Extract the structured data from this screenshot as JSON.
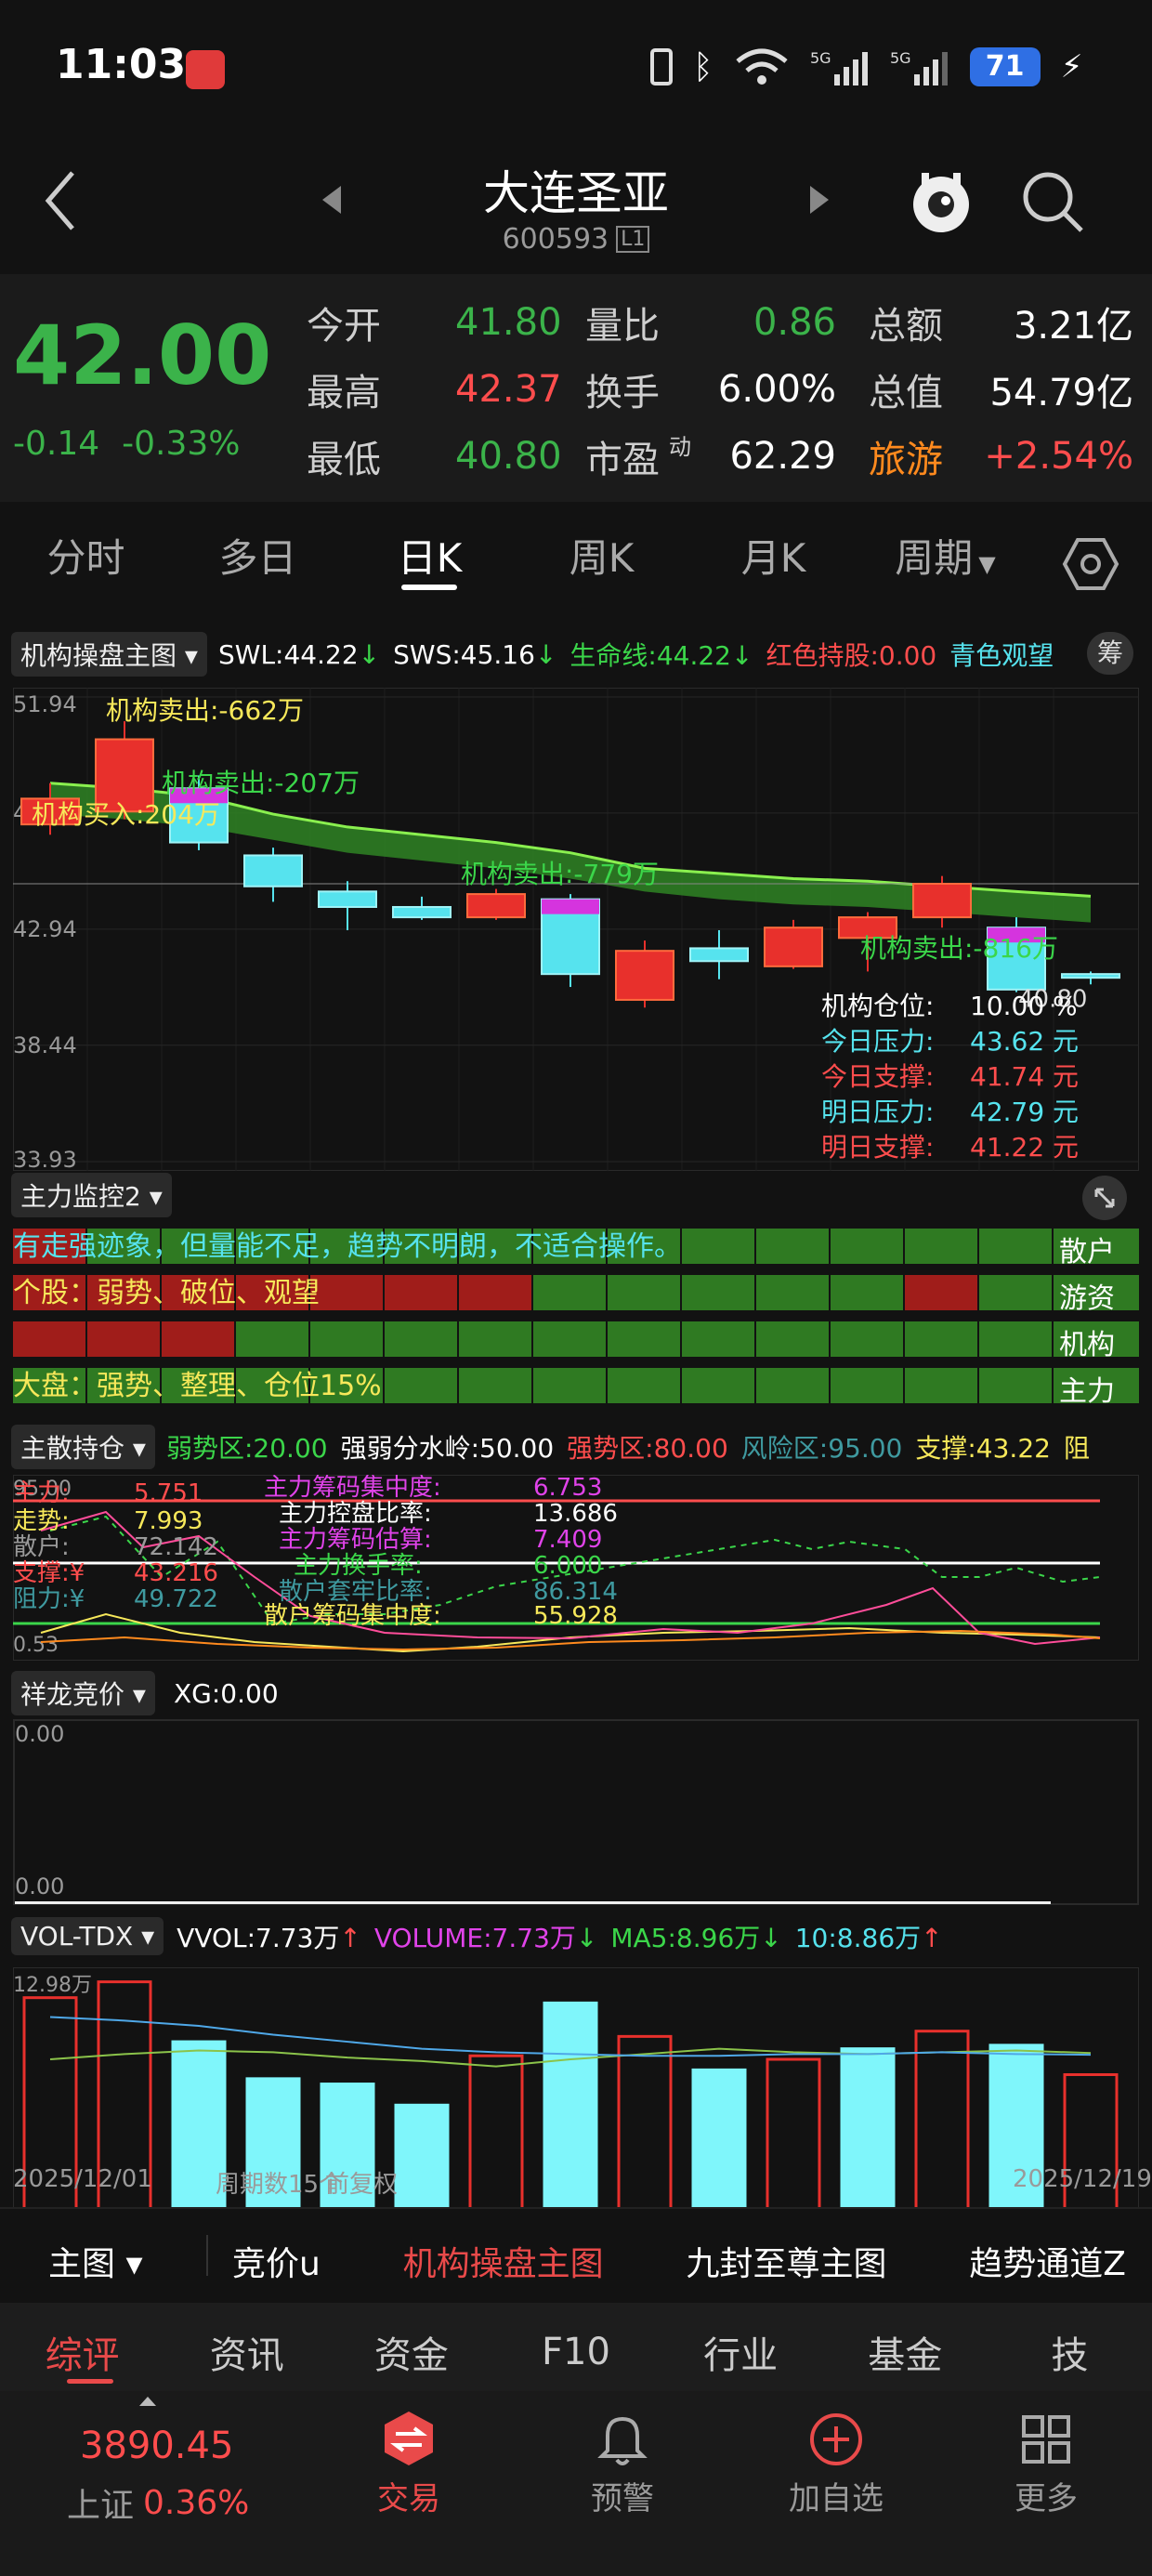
{
  "status_bar": {
    "time": "11:03",
    "battery": "71"
  },
  "header": {
    "title": "大连圣亚",
    "code": "600593",
    "code_badge": "L1"
  },
  "quote": {
    "price": "42.00",
    "change": "-0.14",
    "change_pct": "-0.33%",
    "fields": [
      {
        "label": "今开",
        "value": "41.80",
        "value_color": "#3bb34a"
      },
      {
        "label": "最高",
        "value": "42.37",
        "value_color": "#ff4d4d"
      },
      {
        "label": "最低",
        "value": "40.80",
        "value_color": "#3bb34a"
      }
    ],
    "fields2": [
      {
        "label": "量比",
        "value": "0.86",
        "value_color": "#3bb34a"
      },
      {
        "label": "换手",
        "value": "6.00%",
        "value_color": "#ffffff"
      },
      {
        "label": "市盈",
        "sup": "动",
        "value": "62.29",
        "value_color": "#ffffff"
      }
    ],
    "fields3": [
      {
        "label": "总额",
        "value": "3.21亿"
      },
      {
        "label": "总值",
        "value": "54.79亿"
      },
      {
        "label": "旅游",
        "value": "+2.54%"
      }
    ]
  },
  "period_tabs": [
    "分时",
    "多日",
    "日K",
    "周K",
    "月K",
    "周期"
  ],
  "active_tab": "日K",
  "main_chart": {
    "indicator_name": "机构操盘主图",
    "legend": [
      {
        "text": "SWL:44.22",
        "arrow": "↓",
        "color": "#ffffff"
      },
      {
        "text": "SWS:45.16",
        "arrow": "↓",
        "color": "#ffffff"
      },
      {
        "text": "生命线:44.22",
        "arrow": "↓",
        "color": "#3bd64a"
      },
      {
        "text": "红色持股:0.00",
        "arrow": "",
        "color": "#ff4d4d"
      },
      {
        "text": "青色观望",
        "arrow": "",
        "color": "#56e3ee"
      }
    ],
    "badge": "筹",
    "y_labels": [
      "51.94",
      "47.44",
      "42.94",
      "38.44",
      "33.93"
    ],
    "low_label": "40.80",
    "annotations": [
      {
        "text": "机构卖出:-662万",
        "color": "#f7e85a"
      },
      {
        "text": "机构卖出:-207万",
        "color": "#3bd64a"
      },
      {
        "text": "机构买入:204万",
        "color": "#f7e85a"
      },
      {
        "text": "机构卖出:-779万",
        "color": "#3bd64a"
      },
      {
        "text": "机构卖出:-816万",
        "color": "#3bd64a"
      }
    ],
    "info": [
      {
        "label": "机构仓位:",
        "value": "10.00 %",
        "color": "#ffffff"
      },
      {
        "label": "今日压力:",
        "value": "43.62 元",
        "color": "#56e3ee"
      },
      {
        "label": "今日支撑:",
        "value": "41.74 元",
        "color": "#ff4d4d"
      },
      {
        "label": "明日压力:",
        "value": "42.79 元",
        "color": "#56e3ee"
      },
      {
        "label": "明日支撑:",
        "value": "41.22 元",
        "color": "#ff4d4d"
      }
    ]
  },
  "chart_data": [
    {
      "type": "candlestick",
      "dates": [
        "2025/12/01",
        "2025/12/19"
      ],
      "ylim": [
        33.93,
        51.94
      ],
      "candles": [
        {
          "o": 47.0,
          "c": 48.0,
          "h": 48.6,
          "l": 46.6
        },
        {
          "o": 47.5,
          "c": 50.3,
          "h": 51.0,
          "l": 47.2
        },
        {
          "o": 48.4,
          "c": 46.3,
          "h": 48.9,
          "l": 46.0
        },
        {
          "o": 45.8,
          "c": 44.6,
          "h": 46.1,
          "l": 44.0
        },
        {
          "o": 44.4,
          "c": 43.8,
          "h": 44.8,
          "l": 42.9
        },
        {
          "o": 43.8,
          "c": 43.4,
          "h": 44.2,
          "l": 43.3
        },
        {
          "o": 43.4,
          "c": 44.3,
          "h": 44.5,
          "l": 43.3
        },
        {
          "o": 44.1,
          "c": 41.2,
          "h": 44.3,
          "l": 40.7
        },
        {
          "o": 40.2,
          "c": 42.1,
          "h": 42.5,
          "l": 39.9
        },
        {
          "o": 42.2,
          "c": 41.7,
          "h": 42.9,
          "l": 41.0
        },
        {
          "o": 41.5,
          "c": 43.0,
          "h": 43.3,
          "l": 41.4
        },
        {
          "o": 42.6,
          "c": 43.4,
          "h": 43.6,
          "l": 41.3
        },
        {
          "o": 43.4,
          "c": 44.7,
          "h": 45.0,
          "l": 43.0
        },
        {
          "o": 43.0,
          "c": 40.6,
          "h": 43.4,
          "l": 40.5
        },
        {
          "o": 41.2,
          "c": 41.1,
          "h": 41.3,
          "l": 40.8
        }
      ],
      "life_line": [
        48.6,
        48.4,
        48.1,
        47.4,
        46.9,
        46.6,
        46.3,
        45.9,
        45.3,
        45.1,
        44.9,
        44.8,
        44.6,
        44.4,
        44.22
      ],
      "swl_band": [
        47.4,
        47.2,
        46.9,
        46.4,
        45.9,
        45.6,
        45.3,
        44.9,
        44.4,
        44.1,
        43.9,
        43.8,
        43.6,
        43.4,
        43.2
      ]
    },
    {
      "type": "bar",
      "title": "VOL-TDX",
      "ylim": [
        0,
        12.98
      ],
      "values": [
        12.1,
        13.0,
        9.6,
        7.5,
        7.2,
        6.0,
        8.8,
        11.8,
        9.9,
        8.0,
        8.6,
        9.2,
        10.2,
        9.4,
        7.73
      ],
      "colors": [
        "r",
        "r",
        "c",
        "c",
        "c",
        "c",
        "r",
        "c",
        "r",
        "c",
        "r",
        "c",
        "r",
        "c",
        "r"
      ],
      "ma5": [
        8.6,
        8.9,
        9.1,
        9.0,
        8.7,
        8.5,
        8.2,
        8.6,
        8.9,
        9.2,
        9.0,
        8.9,
        9.0,
        9.1,
        8.96
      ],
      "ma10": [
        11.0,
        10.8,
        10.5,
        10.0,
        9.6,
        9.2,
        9.0,
        8.9,
        8.8,
        8.8,
        8.9,
        8.9,
        9.0,
        8.9,
        8.86
      ]
    }
  ],
  "monitor": {
    "name": "主力监控2",
    "rows": [
      {
        "text": "有走强迹象，但量能不足，趋势不明朗，不适合操作。",
        "label": "散户",
        "color": "#56e3ee"
      },
      {
        "text": "个股：弱势、破位、观望",
        "label": "游资",
        "color": "#f7e85a"
      },
      {
        "text": "",
        "label": "机构",
        "color": "#ffffff"
      },
      {
        "text": "大盘：强势、整理、仓位15%",
        "label": "主力",
        "color": "#f7e85a"
      }
    ],
    "grid": [
      [
        "r",
        "g",
        "g",
        "g",
        "g",
        "g",
        "g",
        "g",
        "g",
        "g",
        "g",
        "g",
        "g",
        "g"
      ],
      [
        "r",
        "r",
        "r",
        "r",
        "r",
        "r",
        "r",
        "g",
        "g",
        "g",
        "g",
        "g",
        "r",
        "g"
      ],
      [
        "r",
        "r",
        "r",
        "g",
        "g",
        "g",
        "g",
        "g",
        "g",
        "g",
        "g",
        "g",
        "g",
        "g"
      ],
      [
        "g",
        "g",
        "g",
        "g",
        "g",
        "g",
        "g",
        "g",
        "g",
        "g",
        "g",
        "g",
        "g",
        "g"
      ]
    ]
  },
  "holding": {
    "name": "主散持仓",
    "legend": [
      {
        "text": "弱势区:20.00",
        "color": "#3bd64a"
      },
      {
        "text": "强弱分水岭:50.00",
        "color": "#ffffff"
      },
      {
        "text": "强势区:80.00",
        "color": "#ff4d4d"
      },
      {
        "text": "风险区:95.00",
        "color": "#3f9aa0"
      },
      {
        "text": "支撑:43.22",
        "color": "#f7e85a"
      },
      {
        "text": "阻",
        "color": "#f7e85a"
      }
    ],
    "y_labels": [
      "95.00",
      "0.53"
    ],
    "left": [
      {
        "label": "主力:",
        "value": "5.751",
        "color": "#ff4d4d"
      },
      {
        "label": "走势:",
        "value": "7.993",
        "color": "#f7e85a"
      },
      {
        "label": "散户:",
        "value": "72.142",
        "color": "#9a9a9a"
      },
      {
        "label": "支撑:¥",
        "value": "43.216",
        "color": "#ff4d4d"
      },
      {
        "label": "阻力:¥",
        "value": "49.722",
        "color": "#3f9aa0"
      }
    ],
    "right": [
      {
        "label": "主力筹码集中度:",
        "value": "6.753",
        "color": "#e043e9"
      },
      {
        "label": "主力控盘比率:",
        "value": "13.686",
        "color": "#ffffff"
      },
      {
        "label": "主力筹码估算:",
        "value": "7.409",
        "color": "#e043e9"
      },
      {
        "label": "主力换手率:",
        "value": "6.000",
        "color": "#3bd64a"
      },
      {
        "label": "散户套牢比率:",
        "value": "86.314",
        "color": "#3f9aa0"
      },
      {
        "label": "散户筹码集中度:",
        "value": "55.928",
        "color": "#f7e85a"
      }
    ]
  },
  "bidding": {
    "name": "祥龙竞价",
    "legend": "XG:0.00",
    "y_top": "0.00",
    "y_bottom": "0.00"
  },
  "volume": {
    "name": "VOL-TDX",
    "legend": [
      {
        "text": "VVOL:7.73万",
        "arrow": "↑",
        "color": "#ffffff",
        "arrow_color": "#ff4d4d"
      },
      {
        "text": "VOLUME:7.73万",
        "arrow": "↓",
        "color": "#e043e9",
        "arrow_color": "#3bd64a"
      },
      {
        "text": "MA5:8.96万",
        "arrow": "↓",
        "color": "#3bd64a",
        "arrow_color": "#3bd64a"
      },
      {
        "text": "10:8.86万",
        "arrow": "↑",
        "color": "#56e3ee",
        "arrow_color": "#ff4d4d"
      }
    ],
    "max_label": "12.98万",
    "footer_left": "2025/12/01",
    "footer_mid1": "周期数15个",
    "footer_mid2": "前复权",
    "footer_right": "2025/12/19"
  },
  "indicator_bar": {
    "main": "主图",
    "items": [
      "竞价u",
      "机构操盘主图",
      "九封至尊主图",
      "趋势通道Z"
    ],
    "active": "机构操盘主图"
  },
  "info_tabs": [
    "综评",
    "资讯",
    "资金",
    "F10",
    "行业",
    "基金",
    "技"
  ],
  "bottom_nav": {
    "index_value": "3890.45",
    "index_name": "上证",
    "index_change": "0.36%",
    "items": [
      "交易",
      "预警",
      "加自选",
      "更多"
    ]
  }
}
